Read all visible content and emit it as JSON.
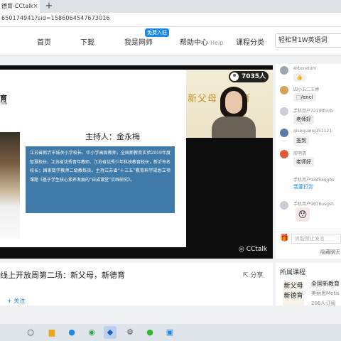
{
  "browser": {
    "tab_title": "德育-CCtalk",
    "tab_close": "×",
    "new_tab": "+",
    "url": "650174941?sid=1586064547673016"
  },
  "site_nav": {
    "items": [
      "首页",
      "下载",
      "我是网师",
      "帮助中心"
    ],
    "badge": "免费入驻",
    "help_en": "Help",
    "extra": "课程分类",
    "search_text": "轻松背1W英语词",
    "search_icon": "search-icon"
  },
  "player": {
    "viewer_count": "7035人",
    "cam_banner": "新父母 新德育",
    "brand": "CCtalk",
    "slide": {
      "logo": "育",
      "logo_sub": "TION",
      "host_line": "主持人：金永梅",
      "bio": "江苏省新沂市城关小学校长、中小学高级教师，全国新教育实验2019年度智慧校长、江苏省优秀青年教师、江苏省优秀少年科技教育校长，新沂市名校长；国家数学教师二级教练员。主持江苏省“十三五”教育科学规划立项课题《基于学生核心素养发展的“自成课堂”实践研究》。"
    }
  },
  "video": {
    "title": "线上开放周第二场：新父母，新德育",
    "share_label": "分享",
    "follow_label": "+ 关注"
  },
  "chat": {
    "messages": [
      {
        "user": "Arboretum",
        "text": "👍",
        "type": "text",
        "top": 0
      },
      {
        "user": "四小五二王博",
        "text": "⬚/encl",
        "type": "text"
      },
      {
        "user": "手机用户7219tfrmb",
        "text": "老师好",
        "type": "text"
      },
      {
        "user": "qiseguang151121",
        "text": "签到",
        "type": "text"
      },
      {
        "user": "廖明清",
        "text": "老师好",
        "type": "text"
      },
      {
        "user": "手机用户9345kqgbs",
        "text": "我要打赏",
        "type": "gift"
      },
      {
        "user": "手机用户9876usgsh",
        "text": "😯",
        "type": "sticker"
      }
    ],
    "input_placeholder": "尚能禁止发言",
    "hide_effects": "隐藏聊天"
  },
  "course_panel": {
    "title": "所属课程",
    "thumb_text": "新父母 新德育",
    "course_name": "全国新教育",
    "author": "美丽思Metis",
    "subscribers": "206人订阅"
  },
  "taskbar": {
    "icons": [
      "search-icon",
      "folder-icon",
      "edge-icon",
      "chrome-icon",
      "cctalk-icon",
      "settings-icon",
      "wechat-icon",
      "window-icon"
    ]
  }
}
